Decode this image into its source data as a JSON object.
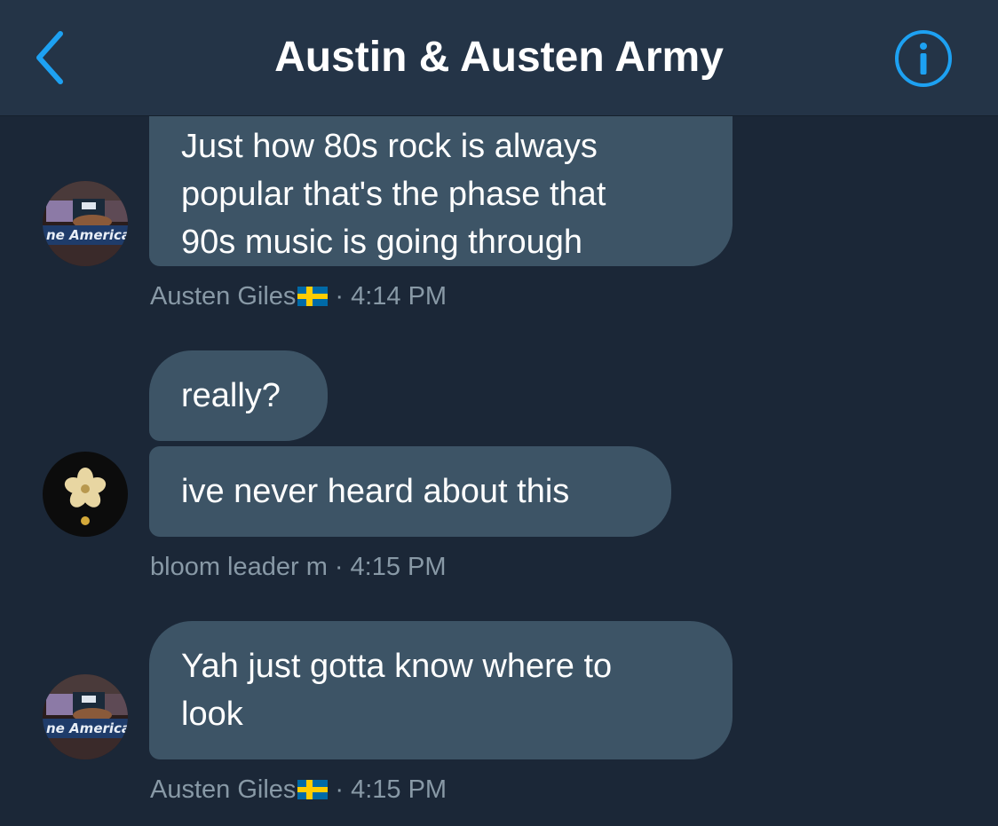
{
  "header": {
    "title": "Austin & Austen Army",
    "back_icon": "chevron-left-icon",
    "info_icon": "info-circle-icon",
    "accent_color": "#1da1f2"
  },
  "messages": [
    {
      "text": "Just how 80s rock is always\npopular that's the phase that\n90s music is going through",
      "sender": "Austen Giles",
      "time": "4:14 PM"
    },
    {
      "text": "really?"
    },
    {
      "text": "ive never heard about this",
      "sender": "bloom leader m",
      "time": "4:15 PM"
    },
    {
      "text": "Yah just gotta know where to\nlook",
      "sender": "Austen Giles",
      "time": "4:15 PM"
    }
  ],
  "meta": {
    "separator": "·"
  },
  "avatars": {
    "austen_giles": {
      "icon": "tv-studio-avatar",
      "caption": "ne America"
    },
    "bloom_leader": {
      "icon": "gold-flower-avatar"
    }
  },
  "colors": {
    "background": "#1b2737",
    "header": "#243447",
    "bubble": "#3d5466",
    "meta_text": "#8899a6"
  }
}
